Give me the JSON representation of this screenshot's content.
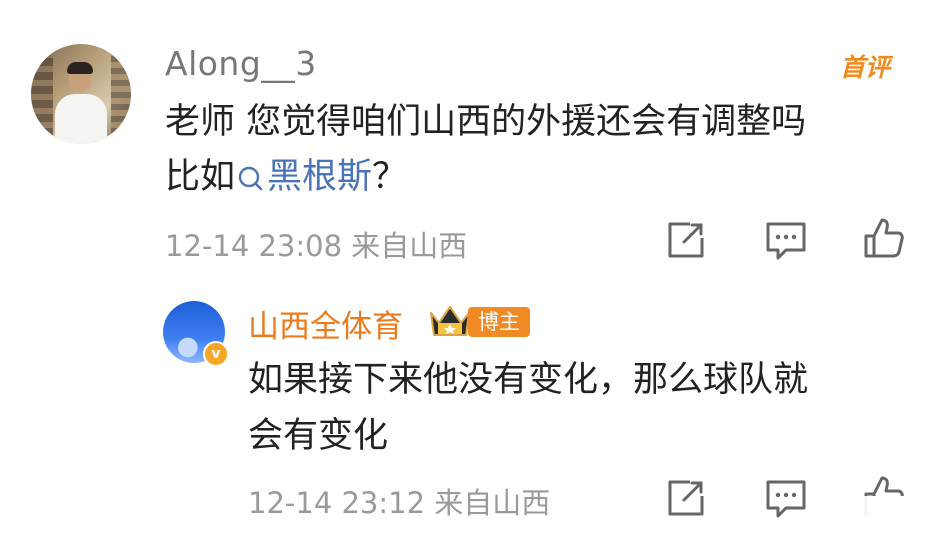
{
  "comment": {
    "username": "Along__3",
    "badge": "首评",
    "text_line1": "老师 您觉得咱们山西的外援还会有调整吗",
    "text_line2_prefix": "比如",
    "topic_link": "黑根斯",
    "text_line2_suffix": "？",
    "meta": "12-14 23:08  来自山西",
    "actions": [
      "share-icon",
      "comment-icon",
      "like-icon"
    ]
  },
  "reply": {
    "username": "山西全体育",
    "role_badge": "博主",
    "text_line1": "如果接下来他没有变化，那么球队就",
    "text_line2": "会有变化",
    "meta": "12-14 23:12  来自山西",
    "actions": [
      "share-icon",
      "comment-icon",
      "like-icon"
    ]
  },
  "colors": {
    "username_gray": "#777777",
    "link_blue": "#4a74b8",
    "accent_orange": "#eb7b1c",
    "meta_gray": "#9a9a9a"
  }
}
